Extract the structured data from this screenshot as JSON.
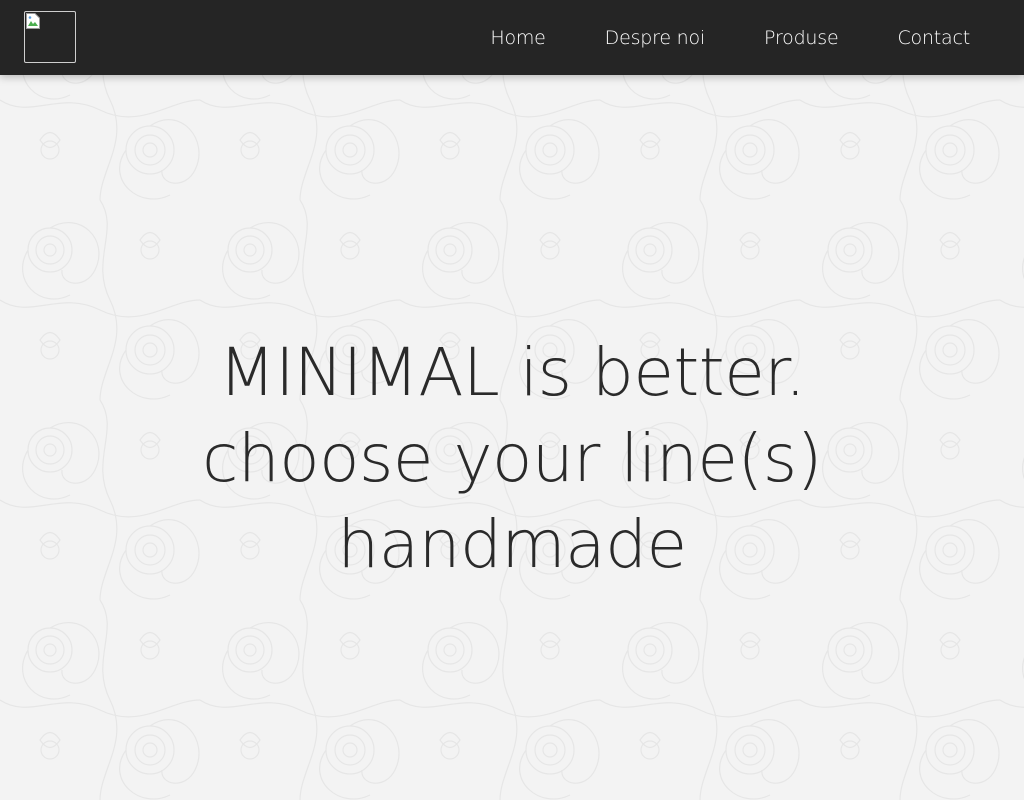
{
  "header": {
    "logo_alt": "",
    "nav": [
      {
        "label": "Home"
      },
      {
        "label": "Despre noi"
      },
      {
        "label": "Produse"
      },
      {
        "label": "Contact"
      }
    ]
  },
  "hero": {
    "lines": [
      "MINIMAL is better.",
      "choose your line(s)",
      "handmade"
    ]
  },
  "colors": {
    "navbar_bg": "#252525",
    "page_bg": "#f3f3f3",
    "nav_text": "#ffffff",
    "hero_text": "#2a2a2a"
  },
  "icons": [
    "broken-image-icon",
    "paisley-background-pattern"
  ]
}
